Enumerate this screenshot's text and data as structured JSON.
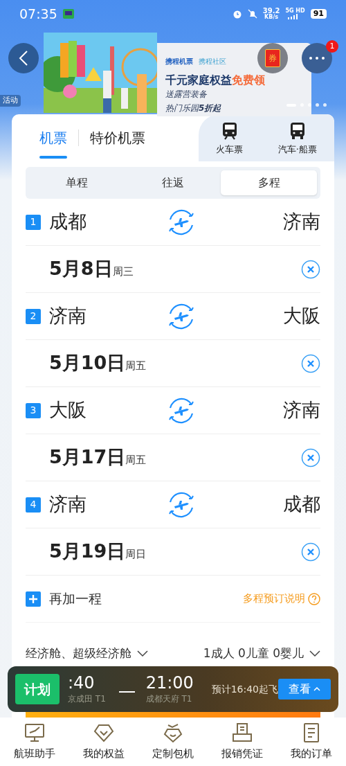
{
  "status_bar": {
    "time": "07:35",
    "speed": "39.2",
    "speed_unit": "KB/s",
    "network": "5G HD",
    "battery": "91"
  },
  "banner": {
    "tag": "活动",
    "brands": [
      "携程机票",
      "携程社区"
    ],
    "headline": "千元家庭权益",
    "highlight": "免费领",
    "lines": [
      "送露营装备",
      "热门乐园**5折起**"
    ],
    "coupon": "券",
    "badge": "1"
  },
  "tabs": [
    {
      "label": "机票",
      "selected": true
    },
    {
      "label": "特价机票",
      "selected": false
    }
  ],
  "transport": [
    {
      "label": "火车票",
      "kind": "train"
    },
    {
      "label": "汽车·船票",
      "kind": "bus"
    }
  ],
  "trip_types": [
    {
      "label": "单程",
      "selected": false
    },
    {
      "label": "往返",
      "selected": false
    },
    {
      "label": "多程",
      "selected": true
    }
  ],
  "legs": [
    {
      "number": "1",
      "from": "成都",
      "to": "济南",
      "date": "5月8日",
      "weekday": "周三"
    },
    {
      "number": "2",
      "from": "济南",
      "to": "大阪",
      "date": "5月10日",
      "weekday": "周五"
    },
    {
      "number": "3",
      "from": "大阪",
      "to": "济南",
      "date": "5月17日",
      "weekday": "周五"
    },
    {
      "number": "4",
      "from": "济南",
      "to": "成都",
      "date": "5月19日",
      "weekday": "周日"
    }
  ],
  "add_leg": "再加一程",
  "help_link": "多程预订说明",
  "cabin": "经济舱、超级经济舱",
  "passengers": "1成人 0儿童 0婴儿",
  "flight_bar": {
    "status": "计划",
    "dep_time": ":40",
    "dep_airport": "京成田 T1",
    "arr_time": "21:00",
    "arr_airport": "成都天府 T1",
    "estimate": "预计16:40起飞",
    "button": "查看"
  },
  "nav": [
    {
      "label": "航班助手",
      "kind": "monitor"
    },
    {
      "label": "我的权益",
      "kind": "diamond"
    },
    {
      "label": "定制包机",
      "kind": "charter"
    },
    {
      "label": "报销凭证",
      "kind": "printer"
    },
    {
      "label": "我的订单",
      "kind": "list"
    }
  ]
}
